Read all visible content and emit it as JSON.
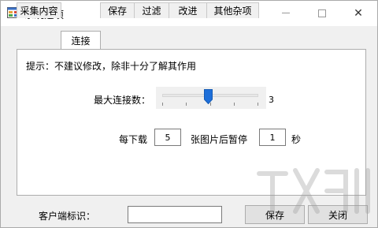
{
  "window": {
    "title": "系统选项",
    "close_glyph": "✕"
  },
  "tabs": [
    {
      "label": "采集内容",
      "active": false
    },
    {
      "label": "连接",
      "active": true
    },
    {
      "label": "保存",
      "active": false
    },
    {
      "label": "过滤",
      "active": false
    },
    {
      "label": "改进",
      "active": false
    },
    {
      "label": "其他杂项",
      "active": false
    }
  ],
  "panel": {
    "hint": "提示：不建议修改，除非十分了解其作用",
    "max_connections_label": "最大连接数：",
    "max_connections_value": "3",
    "pause_prefix": "每下载",
    "pause_count": "5",
    "pause_middle": "张图片后暂停",
    "pause_seconds": "1",
    "pause_unit": "秒"
  },
  "bottom": {
    "client_id_label": "客户端标识：",
    "client_id_value": "",
    "save_label": "保存",
    "close_label": "关闭"
  },
  "colors": {
    "slider_thumb": "#1e6fd9",
    "panel_border": "#adadad"
  }
}
